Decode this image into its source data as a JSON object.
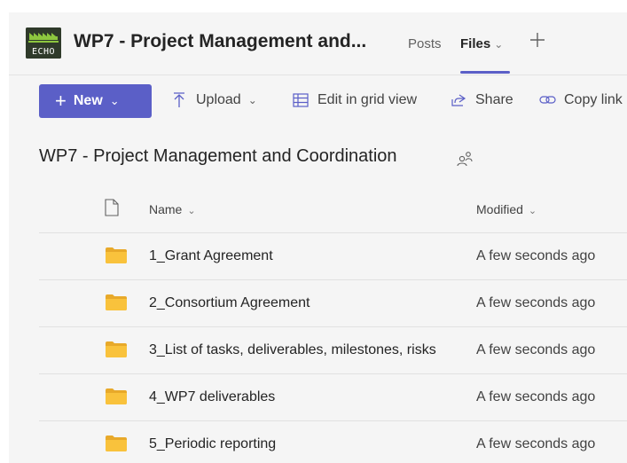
{
  "header": {
    "logo_text": "ECHO",
    "team_title": "WP7 - Project Management and...",
    "tabs": [
      {
        "label": "Posts"
      },
      {
        "label": "Files",
        "chevron": "chevron-down-icon"
      }
    ],
    "add_tab_icon": "plus-icon"
  },
  "commandbar": {
    "new_label": "New",
    "upload_label": "Upload",
    "grid_label": "Edit in grid view",
    "share_label": "Share",
    "copy_label": "Copy link"
  },
  "library": {
    "title": "WP7 - Project Management and Coordination"
  },
  "table": {
    "columns": {
      "name": "Name",
      "modified": "Modified"
    },
    "rows": [
      {
        "name": "1_Grant Agreement",
        "modified": "A few seconds ago"
      },
      {
        "name": "2_Consortium Agreement",
        "modified": "A few seconds ago"
      },
      {
        "name": "3_List of tasks, deliverables, milestones, risks",
        "modified": "A few seconds ago"
      },
      {
        "name": "4_WP7 deliverables",
        "modified": "A few seconds ago"
      },
      {
        "name": "5_Periodic reporting",
        "modified": "A few seconds ago"
      }
    ]
  },
  "colors": {
    "accent": "#5b5fc7",
    "folder": "#f9c23c",
    "background": "#f5f5f5"
  }
}
